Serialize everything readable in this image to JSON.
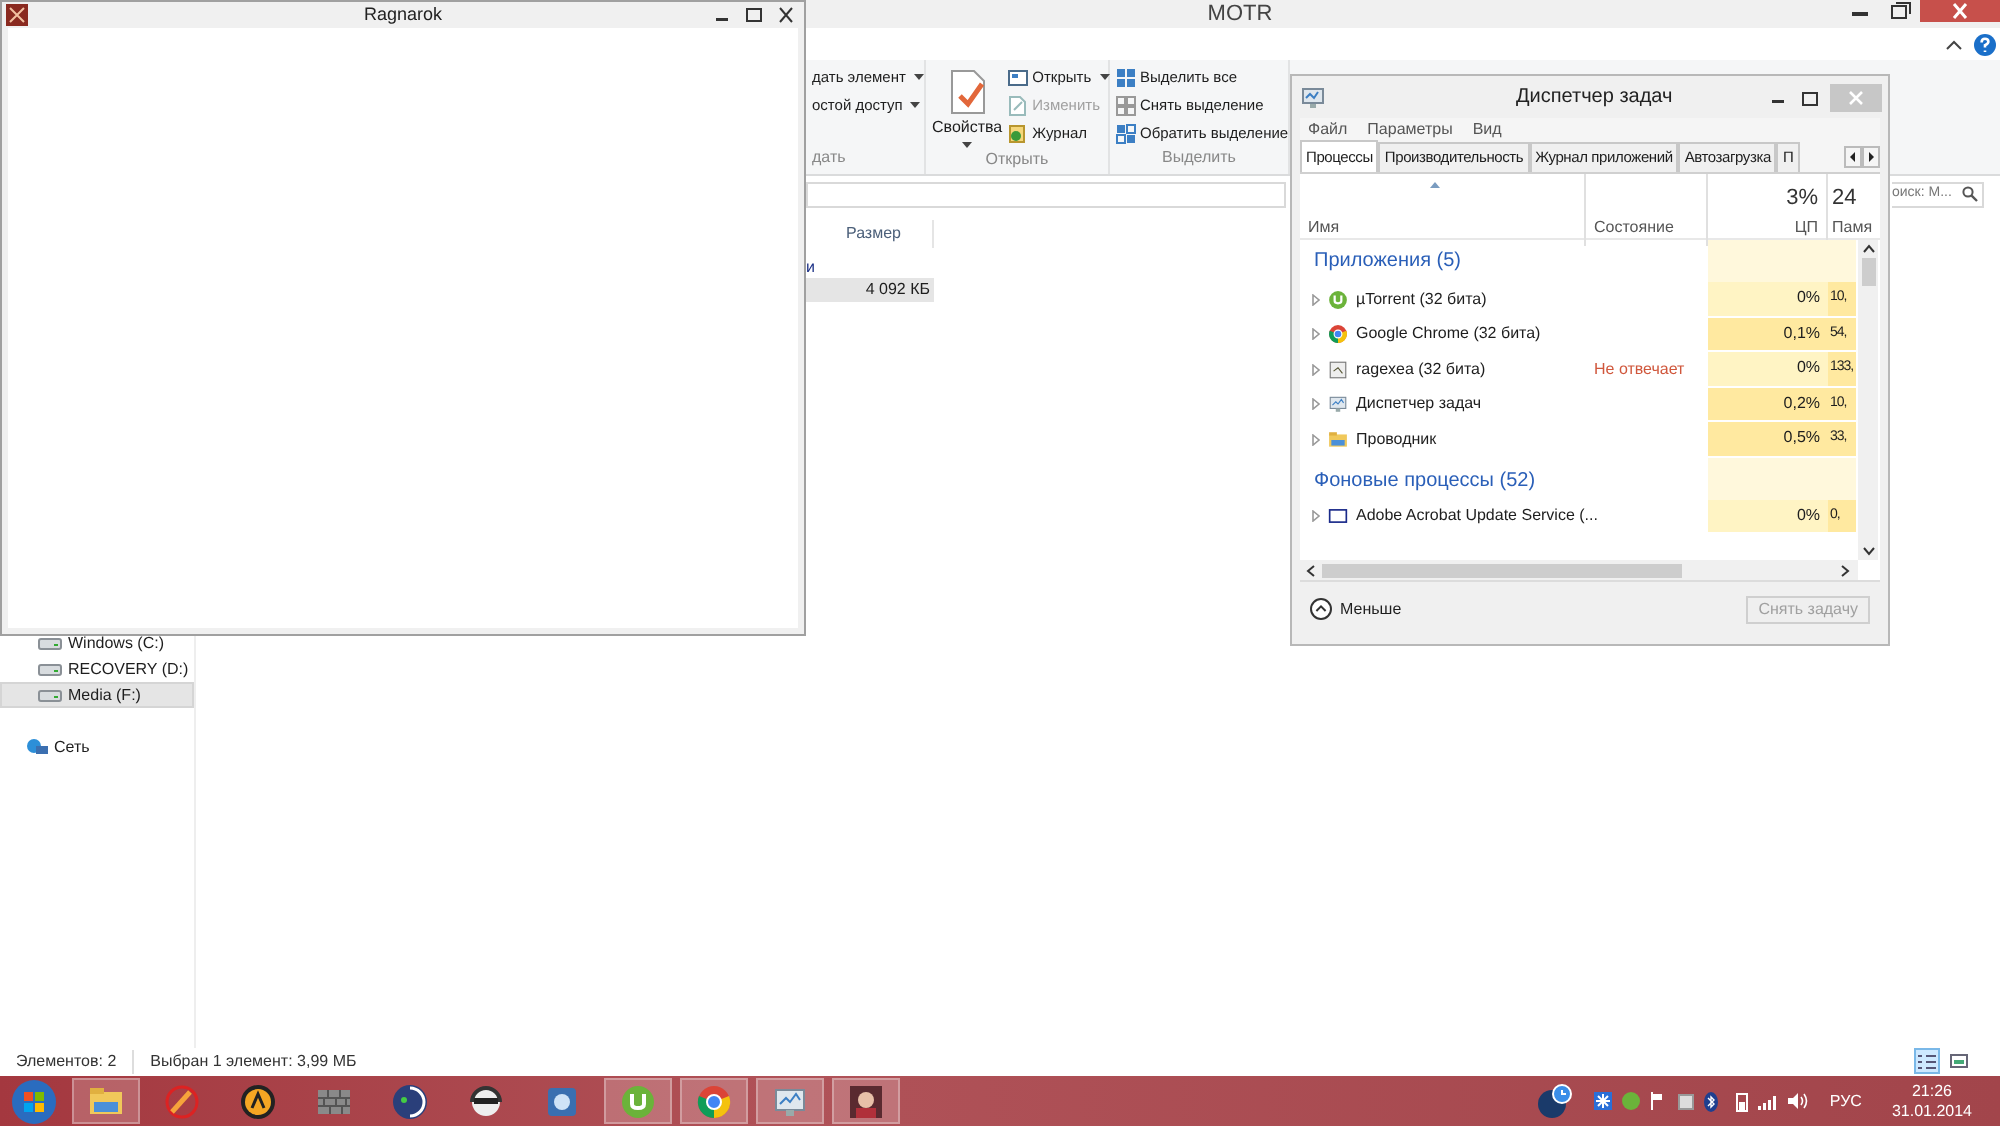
{
  "explorer": {
    "title": "MOTR",
    "ribbon_groups": [
      {
        "label": "дать",
        "commands": [
          {
            "label": "дать элемент",
            "dropdown": true,
            "disabled": false
          },
          {
            "label": "остой доступ",
            "dropdown": true,
            "disabled": false
          }
        ]
      },
      {
        "label": "Открыть",
        "big": {
          "label": "Свойства",
          "dropdown": true
        },
        "commands": [
          {
            "label": "Открыть",
            "dropdown": true,
            "disabled": false
          },
          {
            "label": "Изменить",
            "dropdown": false,
            "disabled": true
          },
          {
            "label": "Журнал",
            "dropdown": false,
            "disabled": false
          }
        ]
      },
      {
        "label": "Выделить",
        "commands": [
          {
            "label": "Выделить все",
            "dropdown": false,
            "disabled": false
          },
          {
            "label": "Снять выделение",
            "dropdown": false,
            "disabled": false
          },
          {
            "label": "Обратить выделение",
            "dropdown": false,
            "disabled": false
          }
        ]
      }
    ],
    "search": {
      "placeholder": "оиск: М..."
    },
    "column": "Размер",
    "group_label": "и",
    "file_row": {
      "size": "4 092 КБ",
      "selected": true
    },
    "nav": [
      {
        "label": "Windows (C:)",
        "kind": "drive",
        "selected": false
      },
      {
        "label": "RECOVERY (D:)",
        "kind": "drive",
        "selected": false
      },
      {
        "label": "Media (F:)",
        "kind": "drive",
        "selected": true
      },
      {
        "label": "Сеть",
        "kind": "network",
        "selected": false
      }
    ],
    "status": [
      "Элементов: 2",
      "Выбран 1 элемент: 3,99 МБ"
    ],
    "views": [
      {
        "kind": "details",
        "selected": true
      },
      {
        "kind": "thumbnails",
        "selected": false
      }
    ]
  },
  "game_window": {
    "title": "Ragnarok"
  },
  "task_manager": {
    "title": "Диспетчер задач",
    "menu": [
      "Файл",
      "Параметры",
      "Вид"
    ],
    "tabs": [
      {
        "label": "Процессы",
        "selected": true
      },
      {
        "label": "Производительность",
        "selected": false
      },
      {
        "label": "Журнал приложений",
        "selected": false
      },
      {
        "label": "Автозагрузка",
        "selected": false
      },
      {
        "label": "П",
        "selected": false
      }
    ],
    "columns": {
      "name": "Имя",
      "status": "Состояние",
      "cpu_total": "3%",
      "cpu": "ЦП",
      "memory_total": "24",
      "memory": "Памя"
    },
    "groups": [
      {
        "label": "Приложения (5)",
        "processes": [
          {
            "name": "µTorrent (32 бита)",
            "kind": "utorrent",
            "cpu": "0%",
            "memory": "10,",
            "busy": false
          },
          {
            "name": "Google Chrome (32 бита)",
            "kind": "chrome",
            "cpu": "0,1%",
            "memory": "54,",
            "busy": true
          },
          {
            "name": "ragexea (32 бита)",
            "kind": "app",
            "status": "Не отвечает",
            "cpu": "0%",
            "memory": "133,",
            "busy": false
          },
          {
            "name": "Диспетчер задач",
            "kind": "monitor",
            "cpu": "0,2%",
            "memory": "10,",
            "busy": true
          },
          {
            "name": "Проводник",
            "kind": "folder",
            "cpu": "0,5%",
            "memory": "33,",
            "busy": true
          }
        ]
      },
      {
        "label": "Фоновые процессы (52)",
        "processes": [
          {
            "name": "Adobe Acrobat Update Service (...",
            "kind": "window",
            "cpu": "0%",
            "memory": "0,",
            "busy": false
          }
        ]
      }
    ],
    "less": "Меньше",
    "end_task": {
      "label": "Снять задачу",
      "disabled": true
    }
  },
  "taskbar": {
    "items": [
      {
        "kind": "folder",
        "running": true
      },
      {
        "kind": "pencil",
        "running": false
      },
      {
        "kind": "letter-circle",
        "running": false
      },
      {
        "kind": "wall",
        "running": false
      },
      {
        "kind": "crescent",
        "running": false
      },
      {
        "kind": "headset",
        "running": false
      },
      {
        "kind": "speaker",
        "running": false
      },
      {
        "kind": "utorrent",
        "running": true
      },
      {
        "kind": "chrome",
        "running": true
      },
      {
        "kind": "monitor",
        "running": true
      },
      {
        "kind": "game",
        "running": true
      }
    ],
    "language": "РУС",
    "time": "21:26",
    "date": "31.01.2014"
  }
}
